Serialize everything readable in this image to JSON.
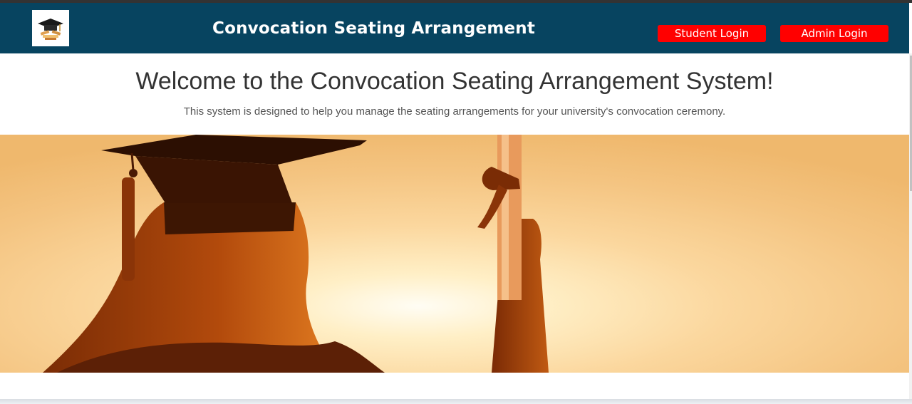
{
  "header": {
    "logo_icon": "graduation-cap-books-icon",
    "title": "Convocation Seating Arrangement",
    "buttons": {
      "student_login": "Student Login",
      "admin_login": "Admin Login"
    }
  },
  "main": {
    "welcome_title": "Welcome to the Convocation Seating Arrangement System!",
    "welcome_text": "This system is designed to help you manage the seating arrangements for your university's convocation ceremony.",
    "hero_image": "graduate-silhouette-sunset-image"
  },
  "colors": {
    "header_bg": "#074460",
    "button_bg": "#ff0000",
    "button_text": "#ffffff",
    "heading_text": "#333333",
    "body_text": "#555555"
  }
}
